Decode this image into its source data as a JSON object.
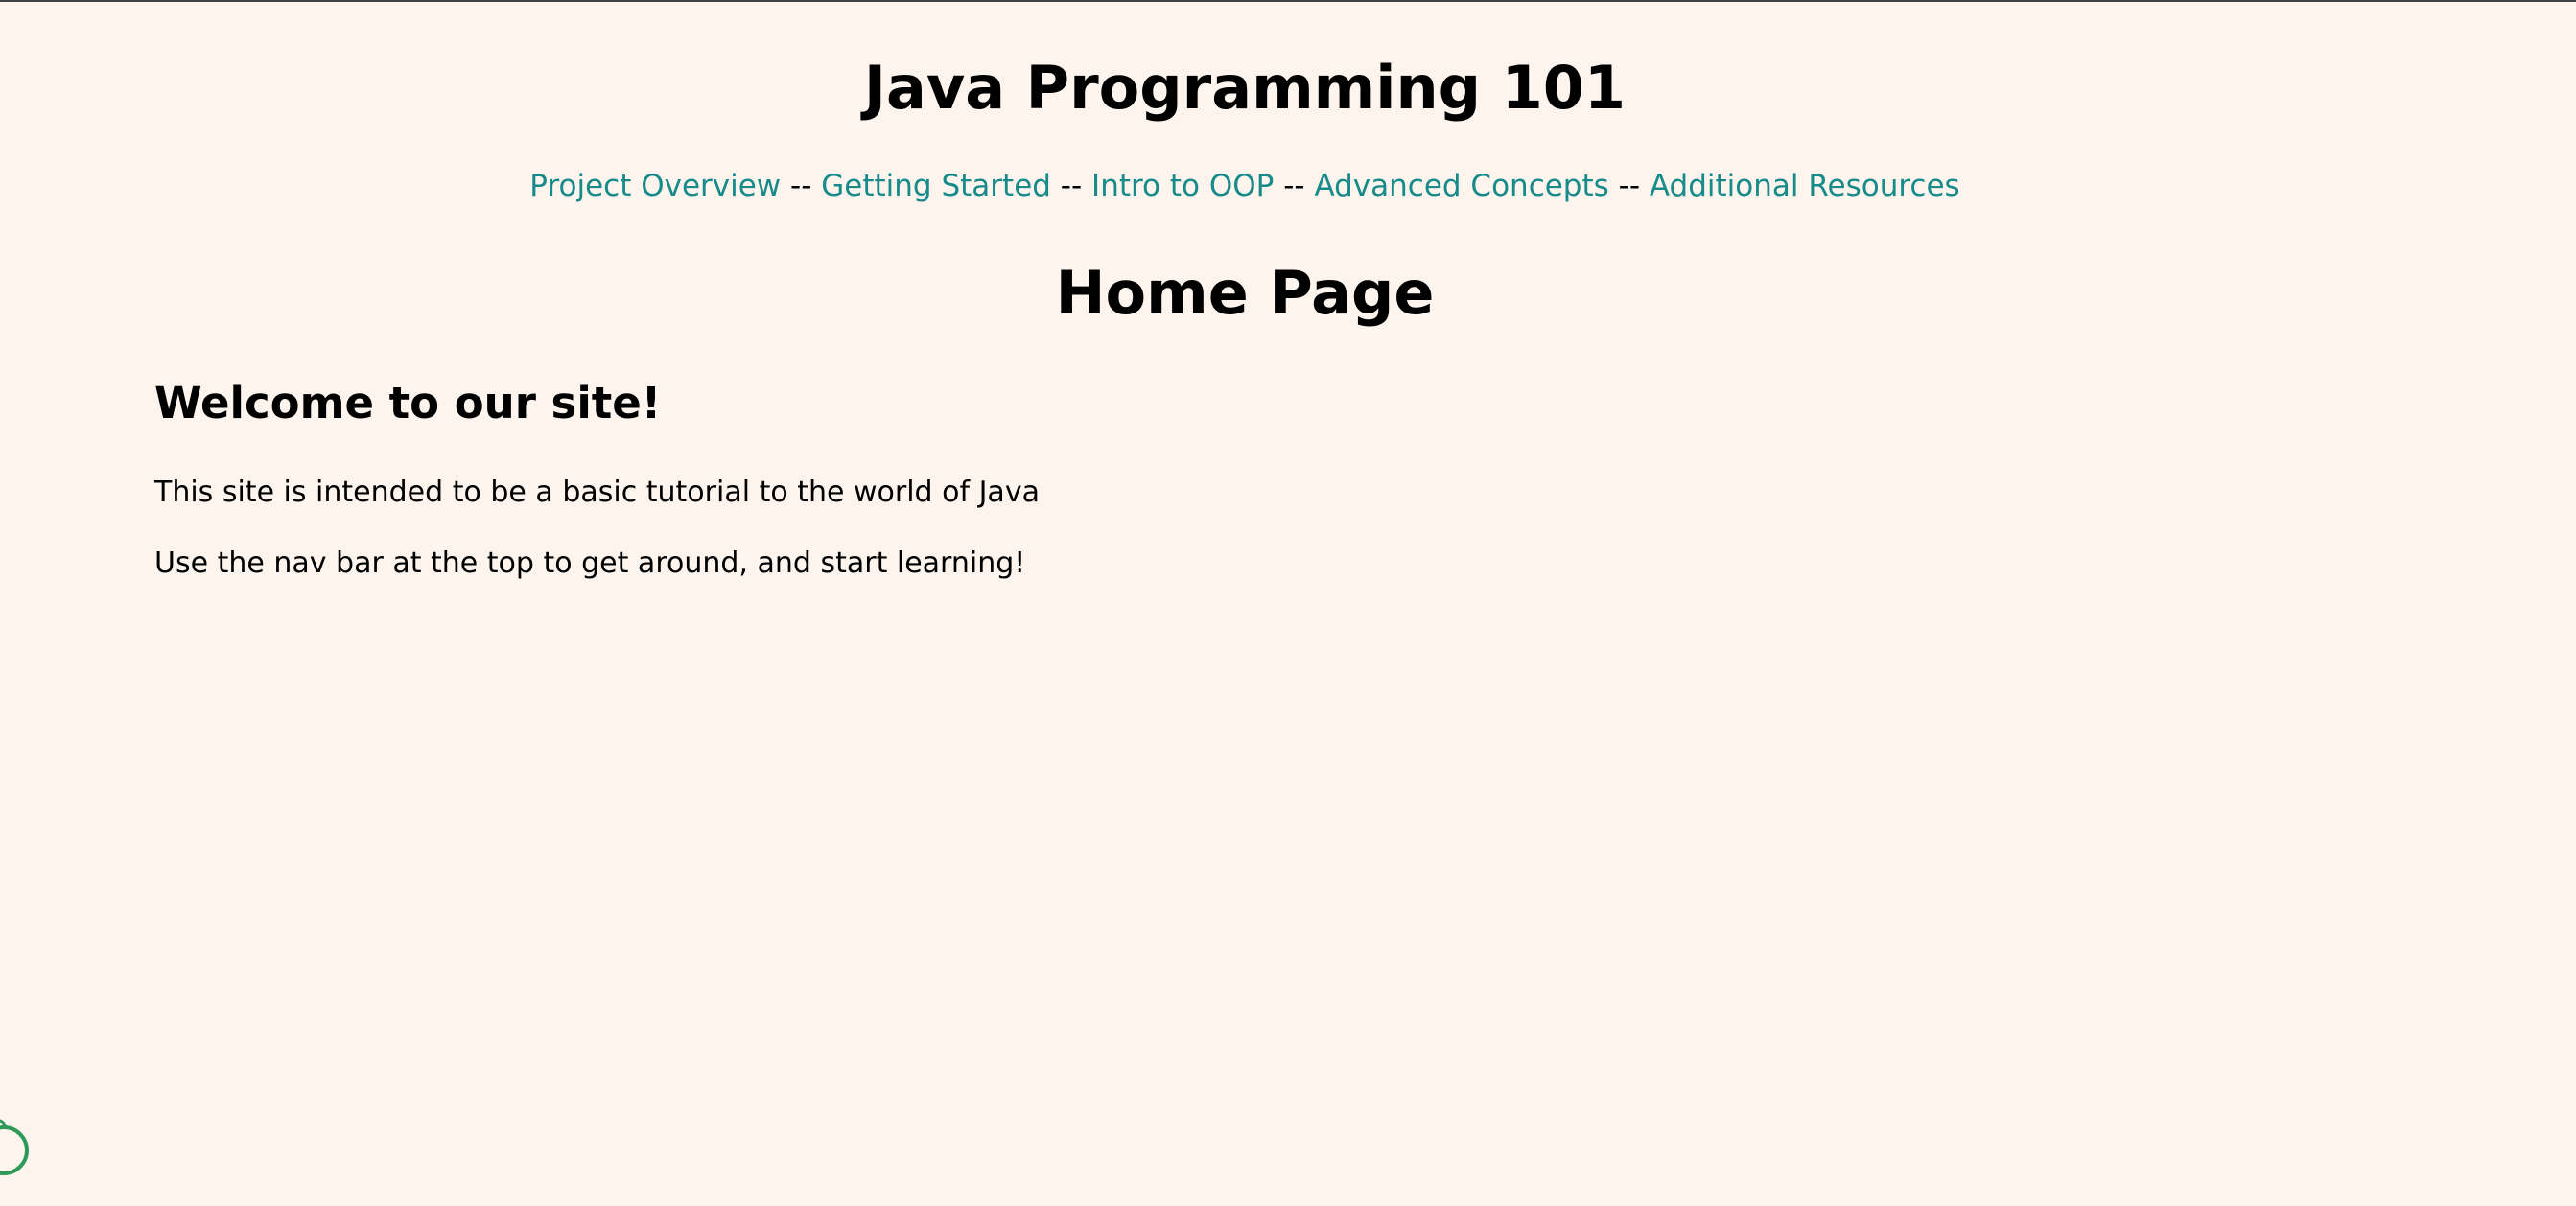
{
  "site": {
    "title": "Java Programming 101"
  },
  "nav": {
    "links": [
      {
        "label": "Project Overview"
      },
      {
        "label": "Getting Started"
      },
      {
        "label": "Intro to OOP"
      },
      {
        "label": "Advanced Concepts"
      },
      {
        "label": "Additional Resources"
      }
    ],
    "separator": " -- "
  },
  "page": {
    "heading": "Home Page",
    "welcome": "Welcome to our site!",
    "paragraphs": [
      "This site is intended to be a basic tutorial to the world of Java",
      "Use the nav bar at the top to get around, and start learning!"
    ]
  },
  "colors": {
    "background": "#fdf4ee",
    "link": "#178a8a",
    "text": "#000000",
    "corner_widget": "#2e9a5a"
  },
  "icons": {
    "corner_widget": "circle-outline-icon"
  }
}
